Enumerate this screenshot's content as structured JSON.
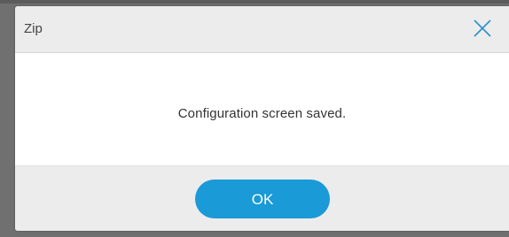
{
  "dialog": {
    "title": "Zip",
    "close_icon": "close-icon",
    "message": "Configuration screen saved.",
    "ok_label": "OK"
  },
  "colors": {
    "accent": "#1a9ad6",
    "titlebar_bg": "#ececec",
    "backdrop": "#707070",
    "close_icon": "#2a8fc9"
  }
}
